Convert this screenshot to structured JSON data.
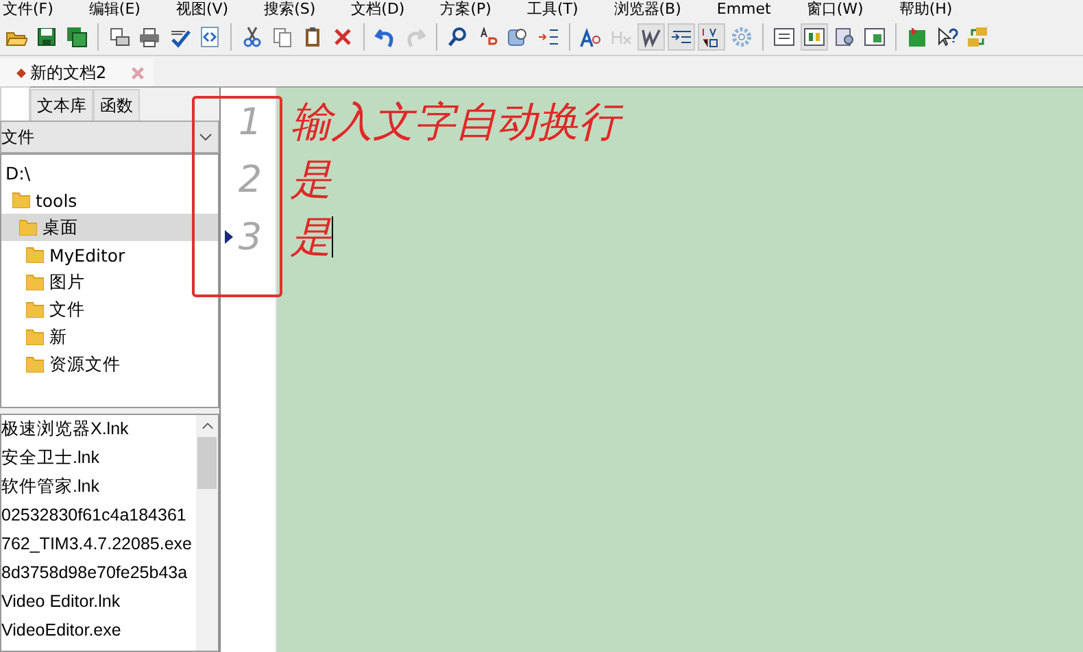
{
  "menu": [
    "文件(F)",
    "编辑(E)",
    "视图(V)",
    "搜索(S)",
    "文档(D)",
    "方案(P)",
    "工具(T)",
    "浏览器(B)",
    "Emmet",
    "窗口(W)",
    "帮助(H)"
  ],
  "toolbar": [
    [
      {
        "disabled": false,
        "pressed": false
      },
      {
        "disabled": false,
        "pressed": false
      },
      {
        "disabled": false,
        "pressed": false
      }
    ],
    [
      {
        "disabled": false,
        "pressed": false
      },
      {
        "disabled": false,
        "pressed": false
      },
      {
        "disabled": false,
        "pressed": false
      },
      {
        "disabled": false,
        "pressed": false
      }
    ],
    [
      {
        "disabled": false,
        "pressed": false
      },
      {
        "disabled": false,
        "pressed": false
      },
      {
        "disabled": false,
        "pressed": false
      },
      {
        "disabled": false,
        "pressed": false
      }
    ],
    [
      {
        "disabled": false,
        "pressed": false
      },
      {
        "disabled": true,
        "pressed": false
      }
    ],
    [
      {
        "disabled": false,
        "pressed": false
      },
      {
        "disabled": false,
        "pressed": false
      },
      {
        "disabled": false,
        "pressed": false
      },
      {
        "disabled": false,
        "pressed": false
      }
    ],
    [
      {
        "disabled": false,
        "pressed": false
      },
      {
        "disabled": true,
        "pressed": false
      },
      {
        "disabled": false,
        "pressed": true
      },
      {
        "disabled": false,
        "pressed": true
      },
      {
        "disabled": false,
        "pressed": true
      },
      {
        "disabled": false,
        "pressed": false
      }
    ],
    [
      {
        "disabled": false,
        "pressed": false
      },
      {
        "disabled": false,
        "pressed": true
      },
      {
        "disabled": false,
        "pressed": false
      },
      {
        "disabled": false,
        "pressed": false
      }
    ],
    [
      {
        "disabled": false,
        "pressed": false
      },
      {
        "disabled": false,
        "pressed": false
      },
      {
        "disabled": false,
        "pressed": false
      }
    ]
  ],
  "document_tabs": [
    {
      "label": "新的文档2",
      "selected": true
    }
  ],
  "sidebar": {
    "tabs": [
      {
        "selected": true
      },
      {
        "label": "文本库",
        "selected": false
      },
      {
        "label": "函数",
        "selected": false
      }
    ],
    "dropdown": {
      "value": "文件"
    },
    "tree": [
      {
        "label": "D:\\",
        "icon": false,
        "selected": false,
        "children": [
          {
            "label": "tools",
            "icon": true,
            "selected": false,
            "children": [
              {
                "label": "桌面",
                "icon": true,
                "selected": true,
                "children": [
                  {
                    "label": "MyEditor",
                    "icon": true,
                    "selected": false
                  },
                  {
                    "label": "图片",
                    "icon": true,
                    "selected": false
                  },
                  {
                    "label": "文件",
                    "icon": true,
                    "selected": false
                  },
                  {
                    "label": "新",
                    "icon": true,
                    "selected": false
                  },
                  {
                    "label": "资源文件",
                    "icon": true,
                    "selected": false
                  }
                ]
              }
            ]
          }
        ]
      }
    ],
    "files": [
      "极速浏览器X.lnk",
      "安全卫士.lnk",
      "软件管家.lnk",
      "02532830f61c4a184361",
      "762_TIM3.4.7.22085.exe",
      "8d3758d98e70fe25b43a",
      "Video Editor.lnk",
      "VideoEditor.exe"
    ]
  },
  "editor": {
    "lines": [
      {
        "number": "1",
        "text": "输入文字自动换行",
        "current": false
      },
      {
        "number": "2",
        "text": "是",
        "current": false
      },
      {
        "number": "3",
        "text": "是",
        "current": true
      }
    ]
  }
}
